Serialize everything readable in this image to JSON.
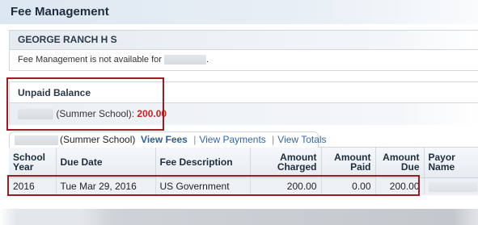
{
  "page_title": "Fee Management",
  "school_panel": {
    "title": "GEORGE RANCH H S",
    "message": "Fee Management is not available for",
    "message_end": "."
  },
  "unpaid_panel": {
    "title": "Unpaid Balance",
    "term_label": "(Summer School):",
    "amount": "200.00",
    "amount_color": "#d21f1f"
  },
  "tabs": {
    "term_label": "(Summer School)",
    "view_fees": "View Fees",
    "separator": "|",
    "view_payments": "View Payments",
    "view_totals": "View Totals"
  },
  "table": {
    "headers": {
      "school_year": "School Year",
      "due_date": "Due Date",
      "fee_description": "Fee Description",
      "amount_charged": "Amount Charged",
      "amount_paid": "Amount Paid",
      "amount_due": "Amount Due",
      "payor_name": "Payor Name"
    },
    "rows": [
      {
        "school_year": "2016",
        "due_date": "Tue Mar 29, 2016",
        "fee_description": "US Government",
        "amount_charged": "200.00",
        "amount_paid": "0.00",
        "amount_due": "200.00",
        "payor_name": ""
      }
    ]
  },
  "colors": {
    "highlight_border": "#9b1c24",
    "link": "#3366aa",
    "header_bg": "#e6ebf1"
  }
}
